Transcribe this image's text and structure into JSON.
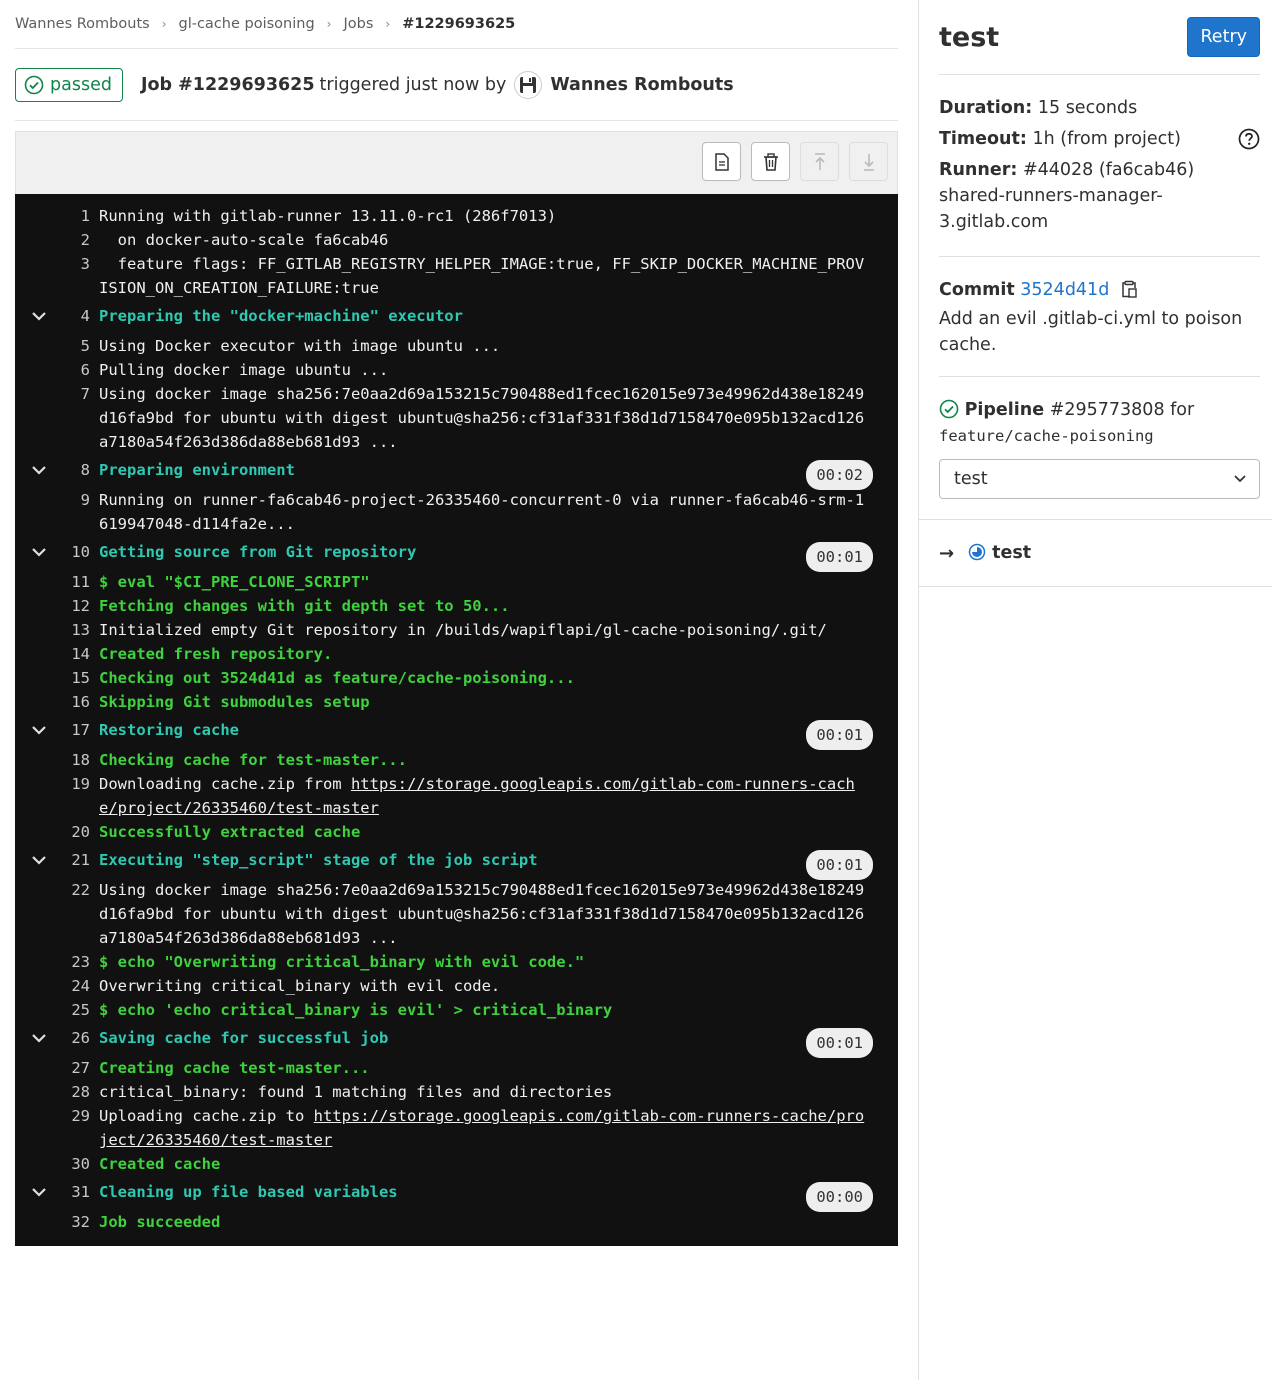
{
  "breadcrumb": [
    "Wannes Rombouts",
    "gl-cache poisoning",
    "Jobs",
    "#1229693625"
  ],
  "header": {
    "status": "passed",
    "job": "Job #1229693625",
    "triggered": "triggered just now by",
    "user": "Wannes Rombouts"
  },
  "log": [
    {
      "n": "1",
      "text": "Running with gitlab-runner 13.11.0-rc1 (286f7013)",
      "style": "plain"
    },
    {
      "n": "2",
      "text": "  on docker-auto-scale fa6cab46",
      "style": "plain"
    },
    {
      "n": "3",
      "text": "  feature flags: FF_GITLAB_REGISTRY_HELPER_IMAGE:true, FF_SKIP_DOCKER_MACHINE_PROVISION_ON_CREATION_FAILURE:true",
      "style": "plain"
    },
    {
      "n": "4",
      "text": "Preparing the \"docker+machine\" executor",
      "style": "section"
    },
    {
      "n": "5",
      "text": "Using Docker executor with image ubuntu ...",
      "style": "plain"
    },
    {
      "n": "6",
      "text": "Pulling docker image ubuntu ...",
      "style": "plain"
    },
    {
      "n": "7",
      "text": "Using docker image sha256:7e0aa2d69a153215c790488ed1fcec162015e973e49962d438e18249d16fa9bd for ubuntu with digest ubuntu@sha256:cf31af331f38d1d7158470e095b132acd126a7180a54f263d386da88eb681d93 ...",
      "style": "plain"
    },
    {
      "n": "8",
      "text": "Preparing environment",
      "style": "section",
      "duration": "00:02"
    },
    {
      "n": "9",
      "text": "Running on runner-fa6cab46-project-26335460-concurrent-0 via runner-fa6cab46-srm-1619947048-d114fa2e...",
      "style": "plain"
    },
    {
      "n": "10",
      "text": "Getting source from Git repository",
      "style": "section",
      "duration": "00:01"
    },
    {
      "n": "11",
      "text": "$ eval \"$CI_PRE_CLONE_SCRIPT\"",
      "style": "green"
    },
    {
      "n": "12",
      "text": "Fetching changes with git depth set to 50...",
      "style": "green"
    },
    {
      "n": "13",
      "text": "Initialized empty Git repository in /builds/wapiflapi/gl-cache-poisoning/.git/",
      "style": "plain"
    },
    {
      "n": "14",
      "text": "Created fresh repository.",
      "style": "green"
    },
    {
      "n": "15",
      "text": "Checking out 3524d41d as feature/cache-poisoning...",
      "style": "green"
    },
    {
      "n": "16",
      "text": "Skipping Git submodules setup",
      "style": "green"
    },
    {
      "n": "17",
      "text": "Restoring cache",
      "style": "section",
      "duration": "00:01"
    },
    {
      "n": "18",
      "text": "Checking cache for test-master...",
      "style": "green"
    },
    {
      "n": "19",
      "prefix": "Downloading cache.zip from ",
      "link": "https://storage.googleapis.com/gitlab-com-runners-cache/project/26335460/test-master",
      "style": "plain"
    },
    {
      "n": "20",
      "text": "Successfully extracted cache",
      "style": "green"
    },
    {
      "n": "21",
      "text": "Executing \"step_script\" stage of the job script",
      "style": "section",
      "duration": "00:01"
    },
    {
      "n": "22",
      "text": "Using docker image sha256:7e0aa2d69a153215c790488ed1fcec162015e973e49962d438e18249d16fa9bd for ubuntu with digest ubuntu@sha256:cf31af331f38d1d7158470e095b132acd126a7180a54f263d386da88eb681d93 ...",
      "style": "plain"
    },
    {
      "n": "23",
      "text": "$ echo \"Overwriting critical_binary with evil code.\"",
      "style": "green"
    },
    {
      "n": "24",
      "text": "Overwriting critical_binary with evil code.",
      "style": "plain"
    },
    {
      "n": "25",
      "text": "$ echo 'echo critical_binary is evil' > critical_binary",
      "style": "green"
    },
    {
      "n": "26",
      "text": "Saving cache for successful job",
      "style": "section",
      "duration": "00:01"
    },
    {
      "n": "27",
      "text": "Creating cache test-master...",
      "style": "green"
    },
    {
      "n": "28",
      "text": "critical_binary: found 1 matching files and directories",
      "style": "plain"
    },
    {
      "n": "29",
      "prefix": "Uploading cache.zip to ",
      "link": "https://storage.googleapis.com/gitlab-com-runners-cache/project/26335460/test-master",
      "style": "plain"
    },
    {
      "n": "30",
      "text": "Created cache",
      "style": "green"
    },
    {
      "n": "31",
      "text": "Cleaning up file based variables",
      "style": "section",
      "duration": "00:00"
    },
    {
      "n": "32",
      "text": "Job succeeded",
      "style": "green"
    }
  ],
  "sidebar": {
    "title": "test",
    "retry": "Retry",
    "duration_label": "Duration:",
    "duration": "15 seconds",
    "timeout_label": "Timeout:",
    "timeout": "1h (from project)",
    "runner_label": "Runner:",
    "runner": "#44028 (fa6cab46) shared-runners-manager-3.gitlab.com",
    "commit_label": "Commit",
    "commit_sha": "3524d41d",
    "commit_message": "Add an evil .gitlab-ci.yml to poison cache.",
    "pipeline_label": "Pipeline",
    "pipeline_id": "#295773808 for",
    "pipeline_ref": "feature/cache-poisoning",
    "stage_selected": "test",
    "job_name": "test"
  },
  "colors": {
    "success": "#108548",
    "link": "#1f75cb",
    "section": "#2fc9b3",
    "green_log": "#3ed23e"
  }
}
